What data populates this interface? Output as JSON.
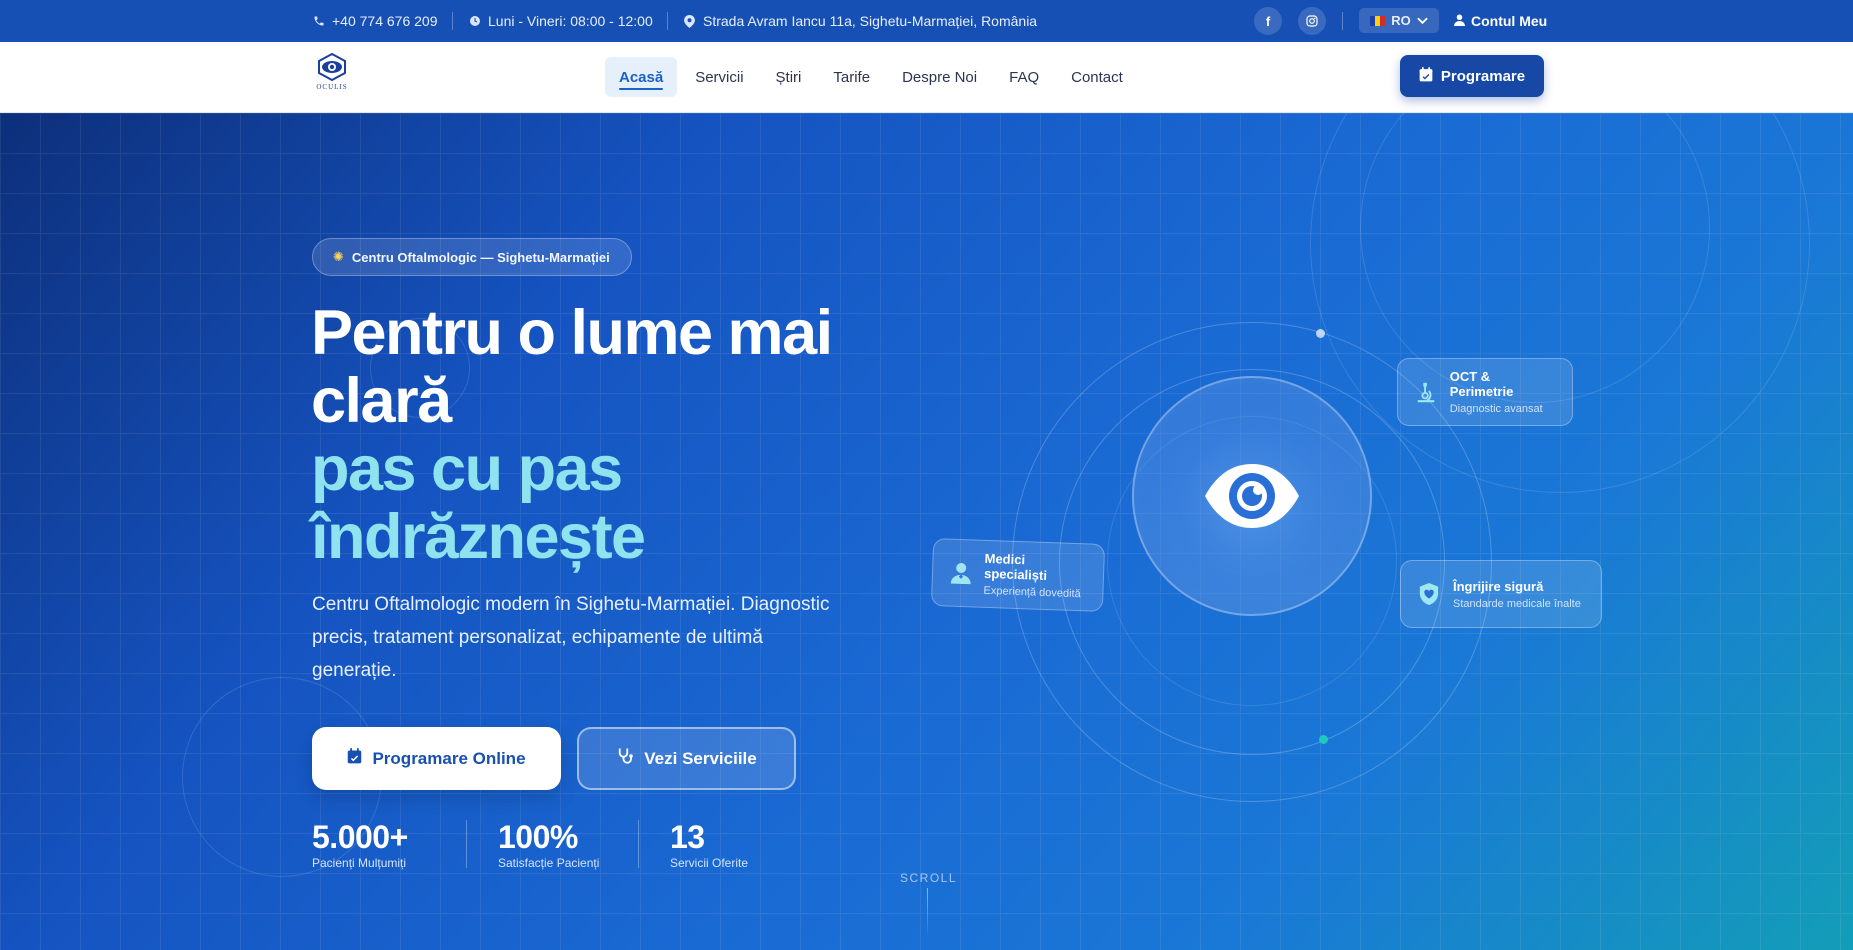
{
  "topbar": {
    "phone": "+40 774 676 209",
    "hours": "Luni - Vineri: 08:00 - 12:00",
    "address": "Strada Avram Iancu 11a, Sighetu-Marmației, România",
    "social": [
      "facebook-icon",
      "instagram-icon"
    ],
    "language": "RO",
    "account": "Contul Meu"
  },
  "nav": {
    "logo_text": "OCULIS",
    "links": [
      {
        "label": "Acasă",
        "active": true
      },
      {
        "label": "Servicii",
        "active": false
      },
      {
        "label": "Știri",
        "active": false
      },
      {
        "label": "Tarife",
        "active": false
      },
      {
        "label": "Despre Noi",
        "active": false
      },
      {
        "label": "FAQ",
        "active": false
      },
      {
        "label": "Contact",
        "active": false
      }
    ],
    "cta": "Programare"
  },
  "hero": {
    "badge": "Centru Oftalmologic — Sighetu-Marmației",
    "title_line1": "Pentru o lume mai",
    "title_line2": "clară",
    "title_line3": "pas cu pas",
    "title_line4": "îndrăznește",
    "lead": "Centru Oftalmologic modern în Sighetu-Marmației. Diagnostic precis, tratament personalizat, echipamente de ultimă generație.",
    "primary_button": "Programare Online",
    "secondary_button": "Vezi Serviciile",
    "stats": [
      {
        "value": "5.000+",
        "label": "Pacienți Mulțumiți"
      },
      {
        "value": "100%",
        "label": "Satisfacție Pacienți"
      },
      {
        "value": "13",
        "label": "Servicii Oferite"
      }
    ],
    "scroll": "SCROLL"
  },
  "features": [
    {
      "title": "OCT & Perimetrie",
      "subtitle": "Diagnostic avansat",
      "icon": "microscope-icon"
    },
    {
      "title": "Îngrijire sigură",
      "subtitle": "Standarde medicale înalte",
      "icon": "shield-heart-icon"
    },
    {
      "title": "Medici specialiști",
      "subtitle": "Experiență dovedită",
      "icon": "doctor-icon"
    }
  ],
  "colors": {
    "topbar": "#1750b4",
    "accent": "#1748a6",
    "highlight_text": "#8ee3ee"
  }
}
